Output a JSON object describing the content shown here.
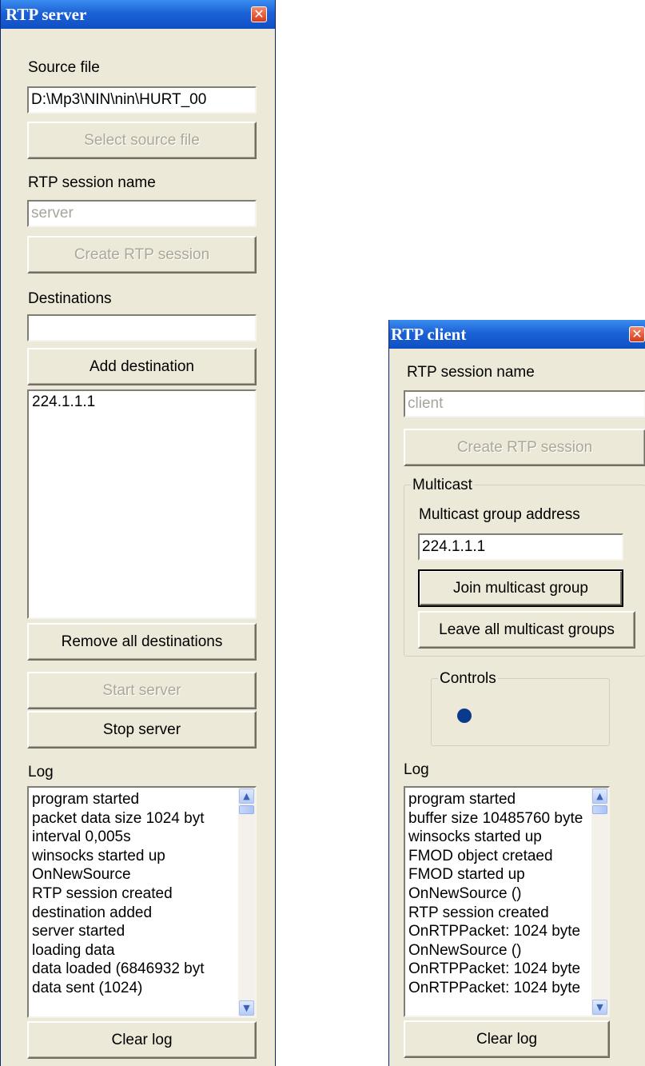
{
  "server": {
    "title": "RTP server",
    "close_glyph": "✕",
    "source_file_label": "Source file",
    "source_file_value": "D:\\Mp3\\NIN\\nin\\HURT_00",
    "select_source_button": "Select source file",
    "session_name_label": "RTP session name",
    "session_name_value": "server",
    "create_session_button": "Create RTP session",
    "destinations_label": "Destinations",
    "destination_input_value": "",
    "add_destination_button": "Add destination",
    "destinations": [
      "224.1.1.1"
    ],
    "remove_all_button": "Remove all destinations",
    "start_button": "Start server",
    "stop_button": "Stop server",
    "log_label": "Log",
    "log_lines": [
      "program started",
      "packet data size 1024 byt",
      "interval 0,005s",
      "winsocks started up",
      "OnNewSource",
      "RTP session created",
      "destination added",
      "server started",
      "loading data",
      "data loaded (6846932 byt",
      "data sent (1024)"
    ],
    "clear_log_button": "Clear log"
  },
  "client": {
    "title": "RTP client",
    "close_glyph": "✕",
    "session_name_label": "RTP session name",
    "session_name_value": "client",
    "create_session_button": "Create RTP session",
    "multicast_group_title": "Multicast",
    "multicast_address_label": "Multicast group address",
    "multicast_address_value": "224.1.1.1",
    "join_button": "Join multicast group",
    "leave_button": "Leave all multicast groups",
    "controls_group_title": "Controls",
    "log_label": "Log",
    "log_lines": [
      "program started",
      "buffer size 10485760 byte",
      "winsocks started up",
      "FMOD object cretaed",
      "FMOD started up",
      "OnNewSource ()",
      "RTP session created",
      "OnRTPPacket: 1024 byte",
      "OnNewSource ()",
      "OnRTPPacket: 1024 byte",
      "OnRTPPacket: 1024 byte"
    ],
    "clear_log_button": "Clear log"
  },
  "icons": {
    "scroll_up": "▲",
    "scroll_down": "▼"
  },
  "colors": {
    "titlebar": "#1b62d6",
    "window_face": "#ece9d8",
    "indicator_dot": "#0a3a8c",
    "close_button": "#d83a1c"
  }
}
